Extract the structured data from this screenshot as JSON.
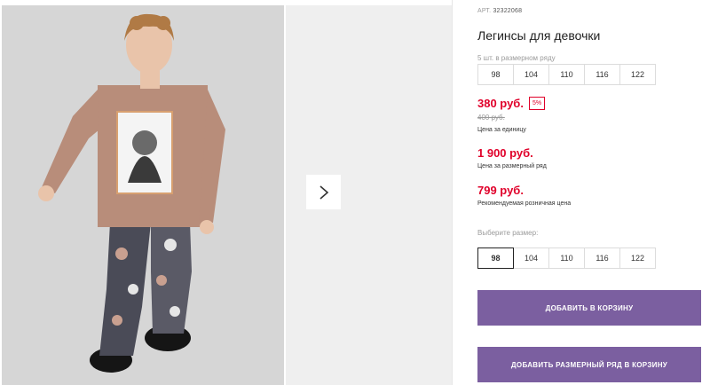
{
  "product": {
    "art_label": "АРТ.",
    "art_value": "32322068",
    "title": "Легинсы для девочки"
  },
  "pack": {
    "label": "5 шт. в размерном ряду",
    "sizes": [
      "98",
      "104",
      "110",
      "116",
      "122"
    ]
  },
  "pricing": {
    "current_price": "380 руб.",
    "discount": "5%",
    "old_price": "400 руб.",
    "unit_label": "Цена за единицу",
    "pack_price": "1 900 руб.",
    "pack_price_label": "Цена за размерный ряд",
    "rrp": "799 руб.",
    "rrp_label": "Рекомендуемая розничная цена"
  },
  "size_select": {
    "label": "Выберите размер:",
    "selected": "98",
    "sizes": [
      "98",
      "104",
      "110",
      "116",
      "122"
    ]
  },
  "actions": {
    "add_to_cart": "ДОБАВИТЬ В КОРЗИНУ",
    "add_pack_to_cart": "ДОБАВИТЬ РАЗМЕРНЫЙ РЯД В КОРЗИНУ"
  },
  "colors": {
    "accent_button": "#7b5fa0",
    "price_red": "#e0002a",
    "photo_background": "#dcdcdc"
  },
  "icons": {
    "next": "chevron-right-icon"
  }
}
